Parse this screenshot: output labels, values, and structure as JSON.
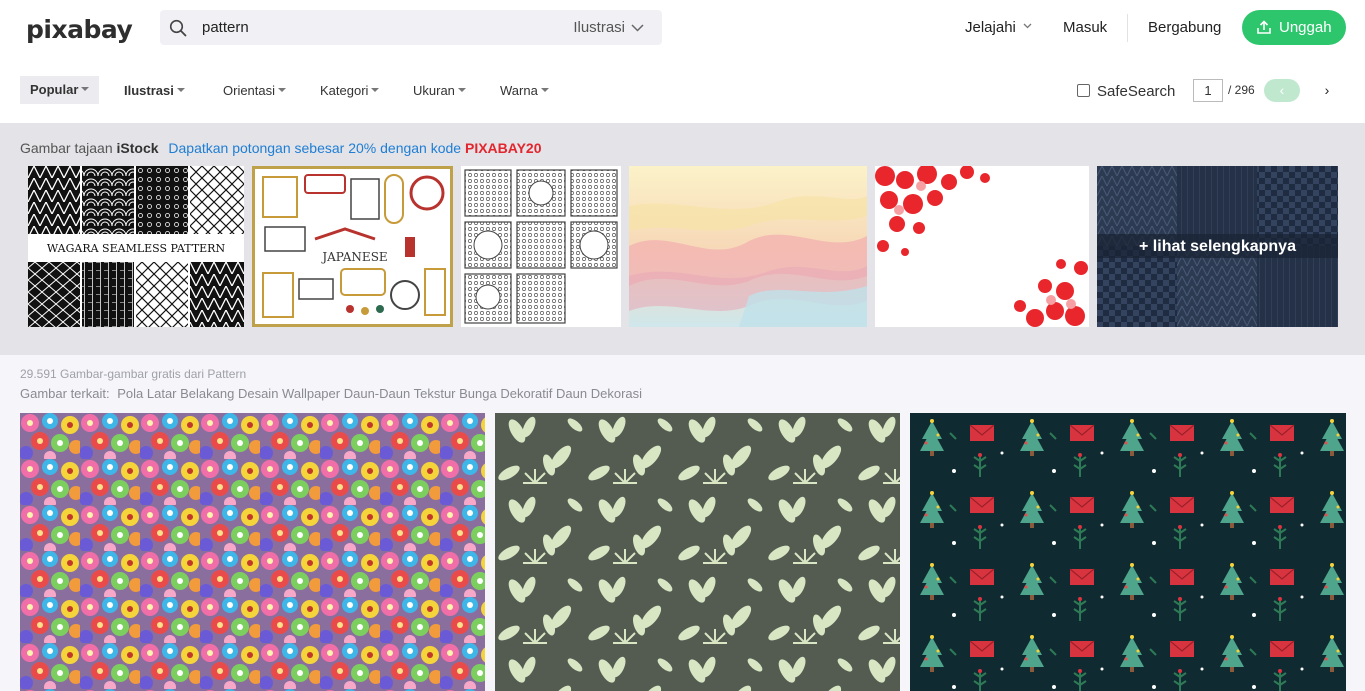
{
  "header": {
    "logo": "pixabay",
    "search_value": "pattern",
    "search_type": "Ilustrasi",
    "nav_explore": "Jelajahi",
    "nav_login": "Masuk",
    "nav_join": "Bergabung",
    "upload_label": "Unggah",
    "accent": "#2ec66d"
  },
  "filters": {
    "popular": "Popular",
    "illustration": "Ilustrasi",
    "orientation": "Orientasi",
    "category": "Kategori",
    "size": "Ukuran",
    "color": "Warna",
    "safesearch": "SafeSearch",
    "page": "1",
    "page_total": "/ 296"
  },
  "istock": {
    "sponsor_prefix": "Gambar tajaan ",
    "sponsor_brand": "iStock",
    "promo": "Dapatkan potongan sebesar 20% dengan kode ",
    "promo_code": "PIXABAY20",
    "thumb1_text": "WAGARA SEAMLESS PATTERN",
    "thumb2_text": "JAPANESE",
    "more_label": "+ lihat selengkapnya"
  },
  "results": {
    "count": "29.591 Gambar-gambar gratis dari Pattern",
    "related_label": "Gambar terkait:",
    "related_tags": [
      "Pola",
      "Latar Belakang",
      "Desain",
      "Wallpaper",
      "Daun-Daun",
      "Tekstur",
      "Bunga",
      "Dekoratif",
      "Daun",
      "Dekorasi"
    ]
  }
}
